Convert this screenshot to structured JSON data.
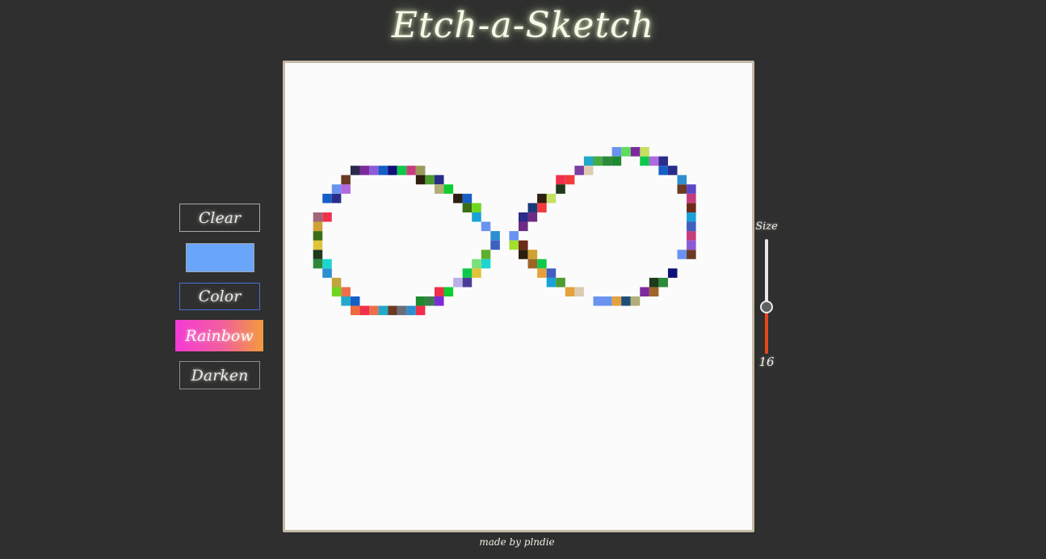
{
  "app": {
    "title": "Etch-a-Sketch",
    "footer": "made by plndie"
  },
  "controls": {
    "clear_label": "Clear",
    "color_label": "Color",
    "rainbow_label": "Rainbow",
    "darken_label": "Darken",
    "selected_color": "#69a5f8"
  },
  "size": {
    "label": "Size",
    "value": "16",
    "fraction": 0.4
  },
  "colors": {
    "background": "#2e2f2e",
    "board": "#fbfbfb",
    "board_border": "#c4b9a6",
    "slider_fill": "#e5471a"
  }
}
